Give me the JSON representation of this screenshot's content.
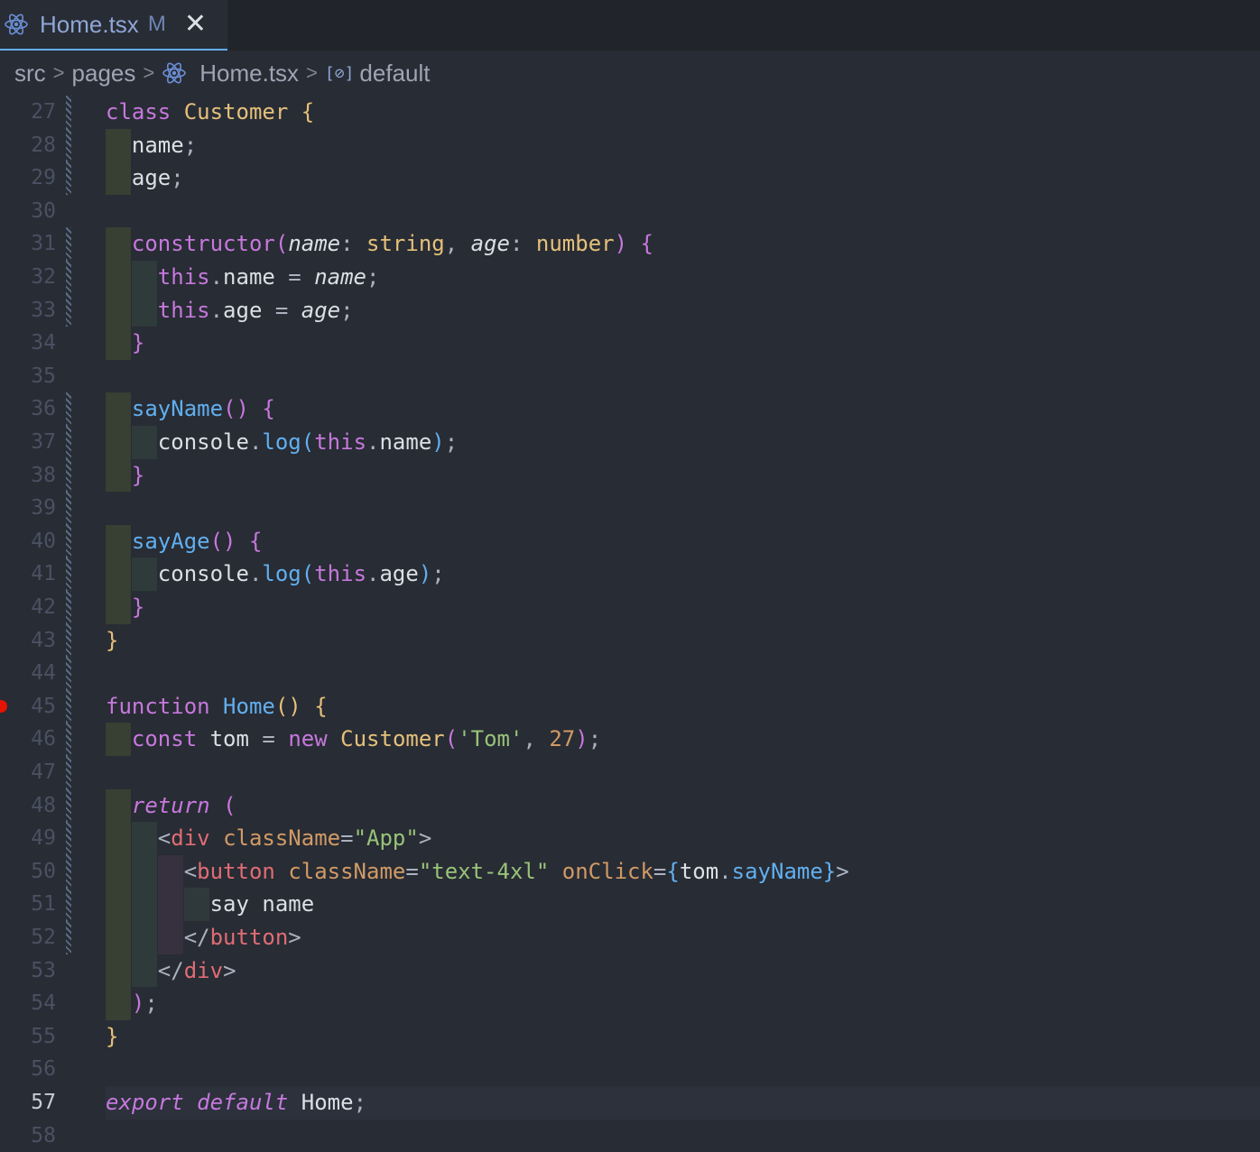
{
  "tab": {
    "filename": "Home.tsx",
    "status": "M",
    "close_glyph": "✕"
  },
  "breadcrumb": {
    "items": [
      "src",
      "pages",
      "Home.tsx",
      "default"
    ],
    "symbol_glyph": "[⊘]"
  },
  "editor": {
    "active_line": 57,
    "breakpoint_line": 45,
    "lines": [
      {
        "n": 27,
        "html": "<span class=\"kw\">class</span> <span class=\"cls\">Customer</span> <span class=\"b1\">{</span>"
      },
      {
        "n": 28,
        "html": "  <span class=\"plain\">name</span>;"
      },
      {
        "n": 29,
        "html": "  <span class=\"plain\">age</span>;"
      },
      {
        "n": 30,
        "html": ""
      },
      {
        "n": 31,
        "html": "  <span class=\"kw\">constructor</span><span class=\"b2\">(</span><span class=\"plain it\">name</span>: <span class=\"cls\">string</span>, <span class=\"plain it\">age</span>: <span class=\"cls\">number</span><span class=\"b2\">)</span> <span class=\"b2\">{</span>"
      },
      {
        "n": 32,
        "html": "    <span class=\"kw\">this</span>.<span class=\"plain\">name</span> = <span class=\"plain it\">name</span>;"
      },
      {
        "n": 33,
        "html": "    <span class=\"kw\">this</span>.<span class=\"plain\">age</span> = <span class=\"plain it\">age</span>;"
      },
      {
        "n": 34,
        "html": "  <span class=\"b2\">}</span>"
      },
      {
        "n": 35,
        "html": ""
      },
      {
        "n": 36,
        "html": "  <span class=\"fn\">sayName</span><span class=\"b2\">()</span> <span class=\"b2\">{</span>"
      },
      {
        "n": 37,
        "html": "    <span class=\"plain\">console</span>.<span class=\"fn\">log</span><span class=\"b3\">(</span><span class=\"kw\">this</span>.<span class=\"plain\">name</span><span class=\"b3\">)</span>;"
      },
      {
        "n": 38,
        "html": "  <span class=\"b2\">}</span>"
      },
      {
        "n": 39,
        "html": ""
      },
      {
        "n": 40,
        "html": "  <span class=\"fn\">sayAge</span><span class=\"b2\">()</span> <span class=\"b2\">{</span>"
      },
      {
        "n": 41,
        "html": "    <span class=\"plain\">console</span>.<span class=\"fn\">log</span><span class=\"b3\">(</span><span class=\"kw\">this</span>.<span class=\"plain\">age</span><span class=\"b3\">)</span>;"
      },
      {
        "n": 42,
        "html": "  <span class=\"b2\">}</span>"
      },
      {
        "n": 43,
        "html": "<span class=\"b1\">}</span>"
      },
      {
        "n": 44,
        "html": ""
      },
      {
        "n": 45,
        "html": "<span class=\"kw\">function</span> <span class=\"fn\">Home</span><span class=\"b1\">()</span> <span class=\"b1\">{</span>"
      },
      {
        "n": 46,
        "html": "  <span class=\"kw\">const</span> <span class=\"plain\">tom</span> = <span class=\"kw\">new</span> <span class=\"cls\">Customer</span><span class=\"b2\">(</span><span class=\"str\">'Tom'</span>, <span class=\"num\">27</span><span class=\"b2\">)</span>;"
      },
      {
        "n": 47,
        "html": ""
      },
      {
        "n": 48,
        "html": "  <span class=\"kw it\">return</span> <span class=\"b2\">(</span>"
      },
      {
        "n": 49,
        "html": "    &lt;<span class=\"tag\">div</span> <span class=\"attr\">className</span>=<span class=\"str\">\"App\"</span>&gt;"
      },
      {
        "n": 50,
        "html": "      &lt;<span class=\"tag\">button</span> <span class=\"attr\">className</span>=<span class=\"str\">\"text-4xl\"</span> <span class=\"attr\">onClick</span>=<span class=\"b3\">{</span><span class=\"plain\">tom</span>.<span class=\"fn\">sayName</span><span class=\"b3\">}</span>&gt;"
      },
      {
        "n": 51,
        "html": "        <span class=\"plain\">say name</span>"
      },
      {
        "n": 52,
        "html": "      &lt;/<span class=\"tag\">button</span>&gt;"
      },
      {
        "n": 53,
        "html": "    &lt;/<span class=\"tag\">div</span>&gt;"
      },
      {
        "n": 54,
        "html": "  <span class=\"b2\">)</span>;"
      },
      {
        "n": 55,
        "html": "<span class=\"b1\">}</span>"
      },
      {
        "n": 56,
        "html": ""
      },
      {
        "n": 57,
        "html": "<span class=\"kw it\">export</span> <span class=\"kw it\">default</span> <span class=\"plain\">Home</span>;"
      },
      {
        "n": 58,
        "html": ""
      }
    ]
  },
  "colors": {
    "background": "#282c34",
    "keyword": "#c678dd",
    "class": "#e5c07b",
    "function": "#61afef",
    "tag": "#e06c75",
    "string": "#98c379",
    "number": "#d19a66",
    "breakpoint": "#e51400"
  },
  "icons": {
    "tab": "react-icon",
    "breadcrumb_file": "react-icon",
    "breadcrumb_symbol": "symbol-variable-icon"
  }
}
